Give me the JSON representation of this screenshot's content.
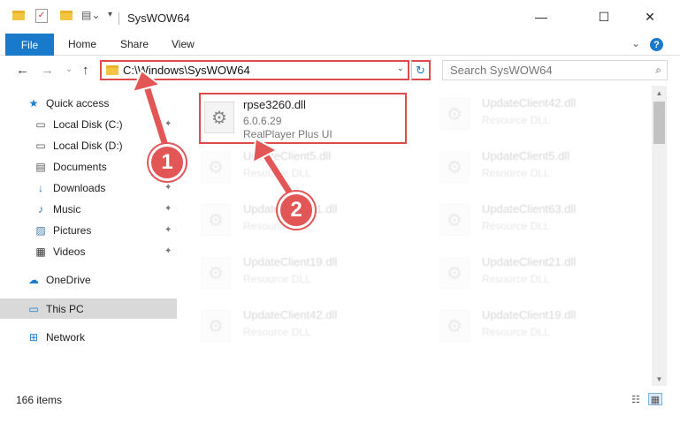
{
  "window": {
    "title": "SysWOW64",
    "minimize": "—",
    "maximize": "☐",
    "close": "✕"
  },
  "ribbon": {
    "file": "File",
    "home": "Home",
    "share": "Share",
    "view": "View",
    "expand": "⌄",
    "help": "?"
  },
  "nav": {
    "back": "←",
    "forward": "→",
    "recent": "⌄",
    "up": "↑",
    "address": "C:\\Windows\\SysWOW64",
    "address_dropdown": "⌄",
    "refresh": "↻",
    "search_placeholder": "Search SysWOW64",
    "search_icon": "⌕"
  },
  "sidebar": {
    "items": [
      {
        "label": "Quick access",
        "icon": "★",
        "icon_color": "#1979ca"
      },
      {
        "label": "Local Disk (C:)",
        "icon": "▭",
        "icon_color": "#555",
        "pinned": true
      },
      {
        "label": "Local Disk (D:)",
        "icon": "▭",
        "icon_color": "#555",
        "pinned": true
      },
      {
        "label": "Documents",
        "icon": "▤",
        "icon_color": "#555",
        "pinned": true
      },
      {
        "label": "Downloads",
        "icon": "↓",
        "icon_color": "#1979ca",
        "pinned": true
      },
      {
        "label": "Music",
        "icon": "♪",
        "icon_color": "#1979ca",
        "pinned": true
      },
      {
        "label": "Pictures",
        "icon": "▨",
        "icon_color": "#4a7fb0",
        "pinned": true
      },
      {
        "label": "Videos",
        "icon": "▦",
        "icon_color": "#333",
        "pinned": true
      },
      {
        "label": "OneDrive",
        "icon": "☁",
        "icon_color": "#1979ca"
      },
      {
        "label": "This PC",
        "icon": "▭",
        "icon_color": "#1979ca",
        "selected": true
      },
      {
        "label": "Network",
        "icon": "⊞",
        "icon_color": "#1979ca"
      }
    ],
    "pin_icon": "✦"
  },
  "files": [
    {
      "name": "rpse3260.dll",
      "version": "6.0.6.29",
      "description": "RealPlayer Plus UI",
      "highlighted": true
    },
    {
      "name": "UpdateClient42.dll",
      "description": "Resource DLL"
    },
    {
      "name": "UpdateClient5.dll",
      "description": "Resource DLL"
    },
    {
      "name": "UpdateClient5.dll",
      "description": "Resource DLL"
    },
    {
      "name": "UpdateClient21.dll",
      "description": "Resource DLL"
    },
    {
      "name": "UpdateClient63.dll",
      "description": "Resource DLL"
    },
    {
      "name": "UpdateClient19.dll",
      "description": "Resource DLL"
    },
    {
      "name": "UpdateClient21.dll",
      "description": "Resource DLL"
    },
    {
      "name": "UpdateClient42.dll",
      "description": "Resource DLL"
    },
    {
      "name": "UpdateClient19.dll",
      "description": "Resource DLL"
    }
  ],
  "status": {
    "count": "166 items"
  },
  "annotations": {
    "step1": "1",
    "step2": "2",
    "color": "#e35656"
  }
}
